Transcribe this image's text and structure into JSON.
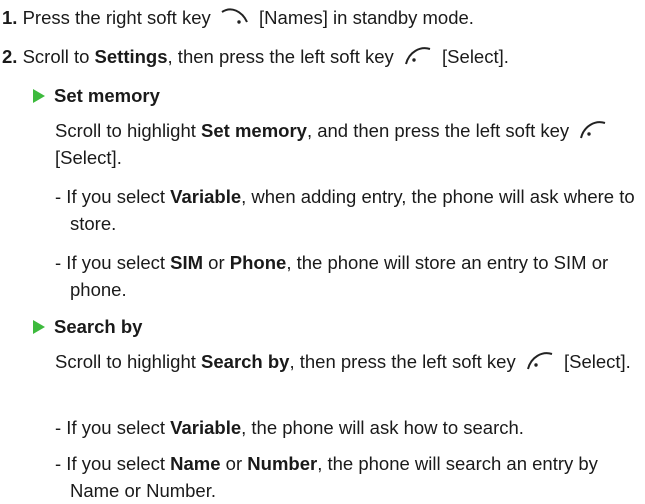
{
  "steps": [
    {
      "num": "1.",
      "pre": " Press the right soft key ",
      "post": " [Names] in standby mode."
    },
    {
      "num": "2.",
      "pre": " Scroll to ",
      "bold": "Settings",
      "mid": ", then press the left soft key ",
      "post": " [Select]."
    }
  ],
  "sections": [
    {
      "heading": "Set memory",
      "para": {
        "pre": "Scroll to highlight ",
        "bold": "Set memory",
        "mid": ", and then press the left soft key ",
        "post": " [Select]."
      },
      "bullets": [
        {
          "pre": "- If you select ",
          "b1": "Variable",
          "post": ", when adding entry, the phone will ask where to store."
        },
        {
          "pre": "- If you select ",
          "b1": "SIM",
          "mid": " or ",
          "b2": "Phone",
          "post": ", the phone will store an entry to SIM or phone."
        }
      ]
    },
    {
      "heading": "Search by",
      "para": {
        "pre": "Scroll to highlight ",
        "bold": "Search by",
        "mid": ", then press the left soft key ",
        "post": " [Select]."
      },
      "bullets": [
        {
          "pre": "- If you select ",
          "b1": "Variable",
          "post": ", the phone will ask how to search."
        },
        {
          "pre": "- If you select ",
          "b1": "Name",
          "mid": " or ",
          "b2": "Number",
          "post": ", the phone will search an entry by Name or Number."
        }
      ]
    }
  ],
  "icons": {
    "right_soft_key": "right-soft-key-icon",
    "left_soft_key": "left-soft-key-icon"
  },
  "colors": {
    "bullet_triangle": "#3dba3d",
    "text": "#1a1a1a"
  }
}
